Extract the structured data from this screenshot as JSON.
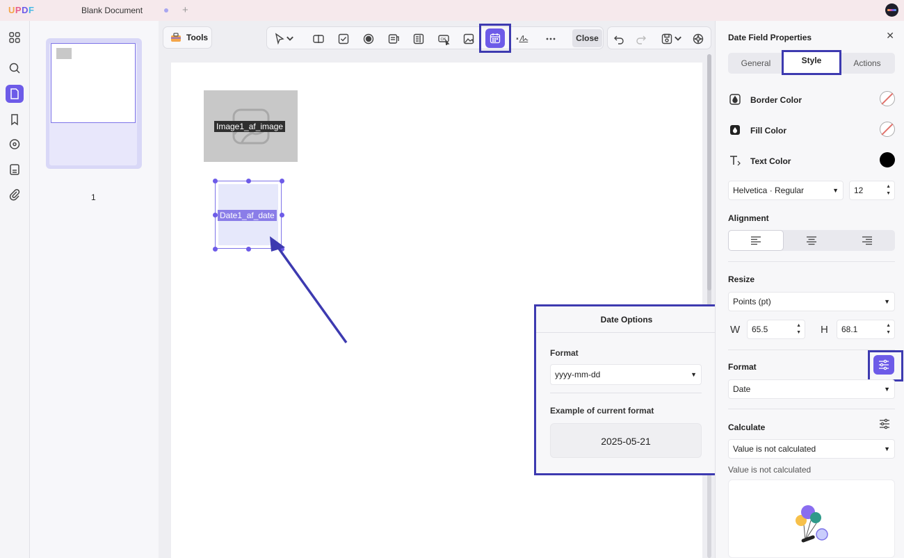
{
  "app": {
    "logo": "UPDF"
  },
  "titlebar": {
    "document_tab": "Blank Document"
  },
  "thumbnails": {
    "pages": [
      {
        "number": "1"
      }
    ]
  },
  "tools": {
    "label": "Tools"
  },
  "toolbar": {
    "close_label": "Close"
  },
  "canvas": {
    "image_field_label": "Image1_af_image",
    "date_field_label": "Date1_af_date"
  },
  "date_options": {
    "title": "Date Options",
    "format_label": "Format",
    "format_value": "yyyy-mm-dd",
    "example_label": "Example of current format",
    "example_value": "2025-05-21"
  },
  "properties": {
    "title": "Date Field Properties",
    "tabs": [
      {
        "label": "General"
      },
      {
        "label": "Style"
      },
      {
        "label": "Actions"
      }
    ],
    "selected_tab": "Style",
    "border_color_label": "Border Color",
    "fill_color_label": "Fill Color",
    "text_color_label": "Text Color",
    "text_color": "#000000",
    "font_value": "Helvetica · Regular",
    "font_size": "12",
    "alignment_label": "Alignment",
    "selected_alignment": "left",
    "resize_label": "Resize",
    "unit_value": "Points (pt)",
    "width_label": "W",
    "width_value": "65.5",
    "height_label": "H",
    "height_value": "68.1",
    "format_label": "Format",
    "format_value": "Date",
    "calculate_label": "Calculate",
    "calculate_value": "Value is not calculated",
    "calculate_note": "Value is not calculated"
  },
  "colors": {
    "accent": "#6d5be8",
    "highlight": "#3d3ab0",
    "annotation_arrow": "#3d3ab0"
  }
}
